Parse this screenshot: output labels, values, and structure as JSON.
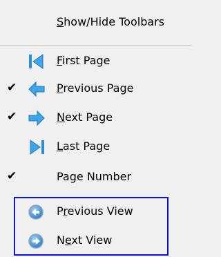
{
  "menu": {
    "items": [
      {
        "label": "Show/Hide Toolbars",
        "accel": "S",
        "rest": "how/Hide Toolbars",
        "checked": false,
        "icon": ""
      },
      {
        "label": "First Page",
        "accel": "F",
        "rest": "irst Page",
        "checked": false,
        "icon": "first-page-icon"
      },
      {
        "label": "Previous Page",
        "accel": "P",
        "rest": "revious Page",
        "checked": true,
        "icon": "previous-page-arrow-icon"
      },
      {
        "label": "Next Page",
        "accel": "N",
        "rest": "ext Page",
        "checked": true,
        "icon": "next-page-arrow-icon"
      },
      {
        "label": "Last Page",
        "accel": "L",
        "rest": "ast Page",
        "checked": false,
        "icon": "last-page-icon"
      },
      {
        "label": "Page Number",
        "accel": "",
        "rest": "Page Number",
        "checked": true,
        "icon": ""
      },
      {
        "label": "Previous View",
        "pre": "P",
        "accel": "r",
        "rest": "evious View",
        "checked": false,
        "icon": "previous-view-icon"
      },
      {
        "label": "Next View",
        "pre": "N",
        "accel": "e",
        "rest": "xt View",
        "checked": false,
        "icon": "next-view-icon"
      }
    ],
    "check_glyph": "✔",
    "highlight_color": "#0b14e6"
  }
}
